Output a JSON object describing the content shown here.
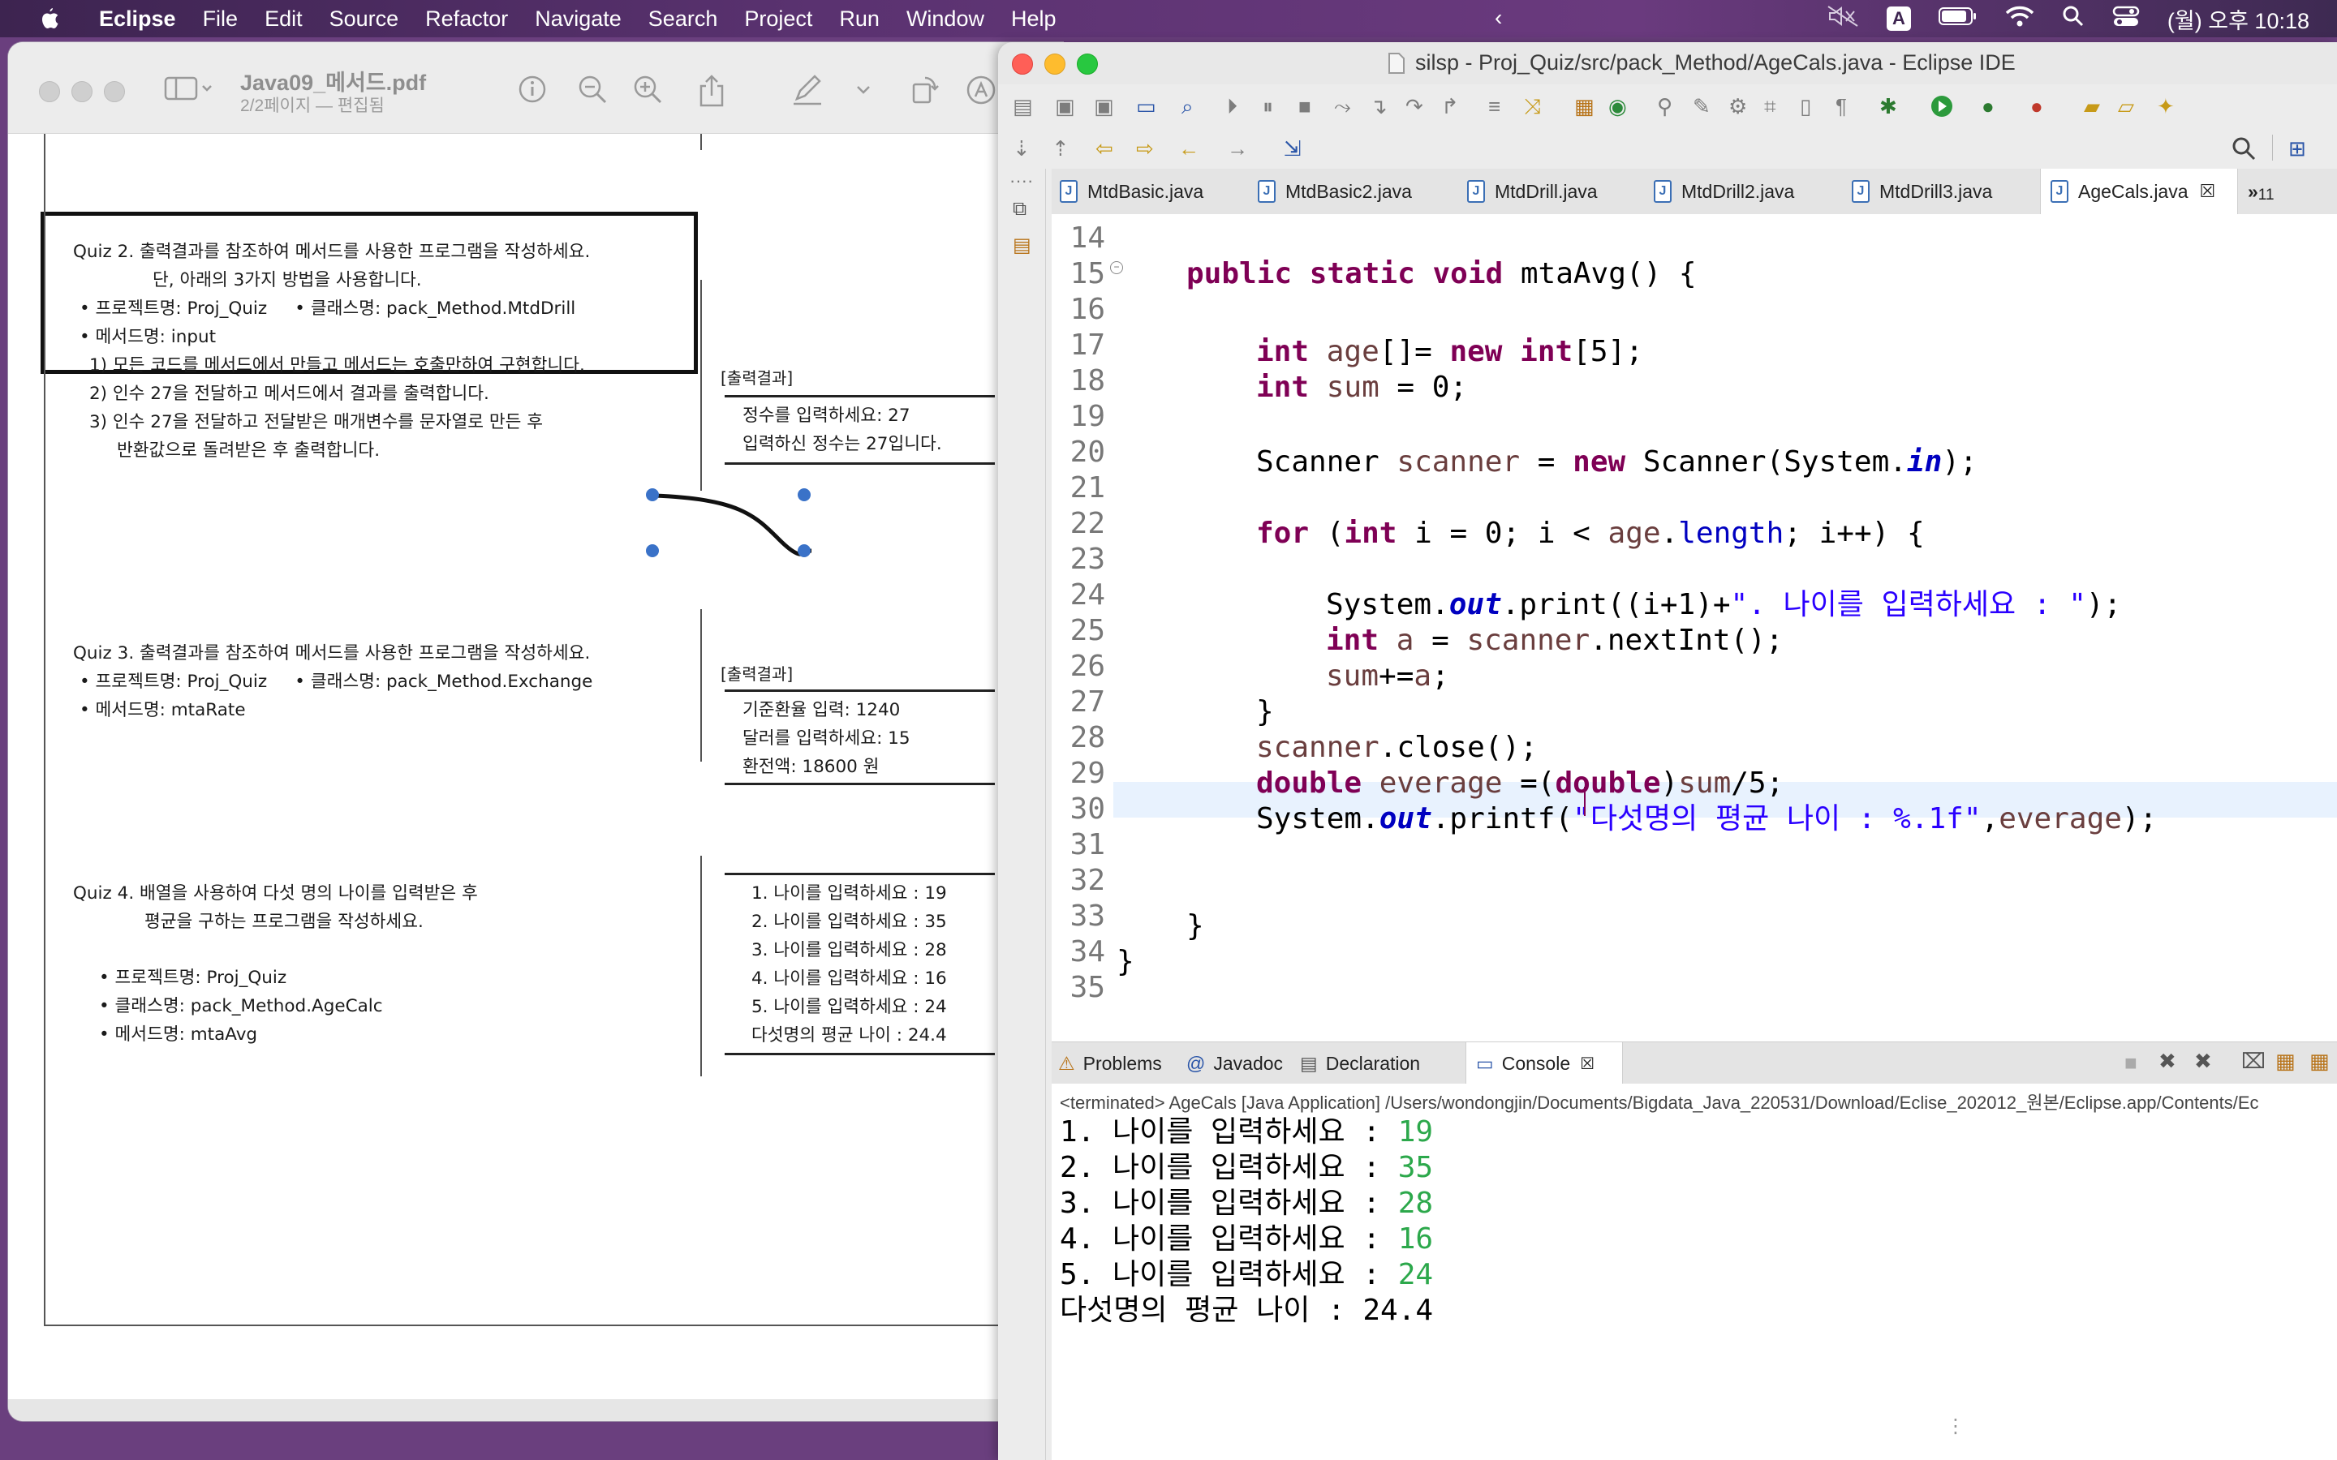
{
  "menubar": {
    "app_name": "Eclipse",
    "items": [
      "File",
      "Edit",
      "Source",
      "Refactor",
      "Navigate",
      "Search",
      "Project",
      "Run",
      "Window",
      "Help"
    ],
    "input_source": "A",
    "clock": "(월) 오후 10:18"
  },
  "preview": {
    "title": "Java09_메서드.pdf",
    "subtitle": "2/2페이지 — 편집됨",
    "quiz2": {
      "lines": [
        "Quiz 2. 출력결과를 참조하여 메서드를 사용한 프로그램을 작성하세요.",
        "단, 아래의 3가지 방법을 사용합니다.",
        "• 프로젝트명: Proj_Quiz     • 클래스명: pack_Method.MtdDrill",
        "• 메서드명: input",
        "1) 모든 코드를 메서드에서 만들고 메서드는 호출만하여 구현합니다.",
        "2) 인수 27을 전달하고 메서드에서 결과를 출력합니다.",
        "3) 인수 27을 전달하고 전달받은 매개변수를 문자열로 만든 후",
        "반환값으로 돌려받은 후 출력합니다."
      ],
      "output_label": "[출력결과]",
      "output": [
        "정수를 입력하세요: 27",
        "입력하신 정수는 27입니다."
      ]
    },
    "quiz3": {
      "lines": [
        "Quiz 3. 출력결과를 참조하여 메서드를 사용한 프로그램을 작성하세요.",
        "• 프로젝트명: Proj_Quiz     • 클래스명: pack_Method.Exchange",
        "• 메서드명: mtaRate"
      ],
      "output_label": "[출력결과]",
      "output": [
        "기준환율 입력: 1240",
        "달러를 입력하세요: 15",
        "환전액: 18600 원"
      ]
    },
    "quiz4": {
      "lines": [
        "Quiz 4. 배열을 사용하여 다섯 명의 나이를 입력받은 후",
        "평균을 구하는 프로그램을 작성하세요.",
        "• 프로젝트명: Proj_Quiz",
        "• 클래스명: pack_Method.AgeCalc",
        "• 메서드명: mtaAvg"
      ],
      "output": [
        "1. 나이를 입력하세요 : 19",
        "2. 나이를 입력하세요 : 35",
        "3. 나이를 입력하세요 : 28",
        "4. 나이를 입력하세요 : 16",
        "5. 나이를 입력하세요 : 24",
        "다섯명의 평균 나이 : 24.4"
      ]
    }
  },
  "eclipse": {
    "title": "silsp - Proj_Quiz/src/pack_Method/AgeCals.java - Eclipse IDE",
    "tabs": [
      "MtdBasic.java",
      "MtdBasic2.java",
      "MtdDrill.java",
      "MtdDrill2.java",
      "MtdDrill3.java",
      "AgeCals.java"
    ],
    "active_tab": "AgeCals.java",
    "overflow_count": "11",
    "line_numbers": [
      "14",
      "15",
      "16",
      "17",
      "18",
      "19",
      "20",
      "21",
      "22",
      "23",
      "24",
      "25",
      "26",
      "27",
      "28",
      "29",
      "30",
      "31",
      "32",
      "33",
      "34",
      "35"
    ],
    "bottom_tabs": [
      "Problems",
      "Javadoc",
      "Declaration",
      "Console"
    ],
    "active_bottom_tab": "Console",
    "console_header": "<terminated> AgeCals [Java Application] /Users/wondongjin/Documents/Bigdata_Java_220531/Download/Eclise_202012_원본/Eclipse.app/Contents/Ec",
    "console_prompts": [
      "1. 나이를 입력하세요 : ",
      "2. 나이를 입력하세요 : ",
      "3. 나이를 입력하세요 : ",
      "4. 나이를 입력하세요 : ",
      "5. 나이를 입력하세요 : "
    ],
    "console_inputs": [
      "19",
      "35",
      "28",
      "16",
      "24"
    ],
    "console_result": "다섯명의 평균 나이 : 24.4"
  },
  "code": {
    "l15_kw1": "public",
    "l15_kw2": "static",
    "l15_kw3": "void",
    "l15_rest": " mtaAvg() {",
    "l17_kw": "int",
    "l17_var": "age",
    "l17_mid": "[]= ",
    "l17_kw2": "new",
    "l17_kw3": "int",
    "l17_end": "[5];",
    "l18_kw": "int",
    "l18_var": "sum",
    "l18_end": " = 0;",
    "l20_a": "Scanner ",
    "l20_var": "scanner",
    "l20_b": " = ",
    "l20_kw": "new",
    "l20_c": " Scanner(System.",
    "l20_fld": "in",
    "l20_d": ");",
    "l22_kw": "for",
    "l22_a": " (",
    "l22_kw2": "int",
    "l22_b": " i = 0; i < ",
    "l22_var": "age",
    "l22_c": ".",
    "l22_fld": "length",
    "l22_d": "; i++) {",
    "l24_a": "System.",
    "l24_fld": "out",
    "l24_b": ".print((i+1)+",
    "l24_str": "\". 나이를 입력하세요 : \"",
    "l24_c": ");",
    "l25_kw": "int",
    "l25_var": "a",
    "l25_b": " = ",
    "l25_var2": "scanner",
    "l25_c": ".nextInt();",
    "l26_var": "sum",
    "l26_b": "+=",
    "l26_var2": "a",
    "l26_c": ";",
    "l27": "}",
    "l28_var": "scanner",
    "l28_b": ".close();",
    "l29_kw": "double",
    "l29_var": "everage",
    "l29_b": " =(",
    "l29_kw2": "double",
    "l29_c": ")",
    "l29_var2": "sum",
    "l29_d": "/5;",
    "l30_a": "System.",
    "l30_fld": "out",
    "l30_b": ".printf(",
    "l30_str": "\"다섯명의 평균 나이 : %.1f\"",
    "l30_c": ",",
    "l30_var": "everage",
    "l30_d": ");",
    "l33": "}",
    "l34": "}"
  }
}
